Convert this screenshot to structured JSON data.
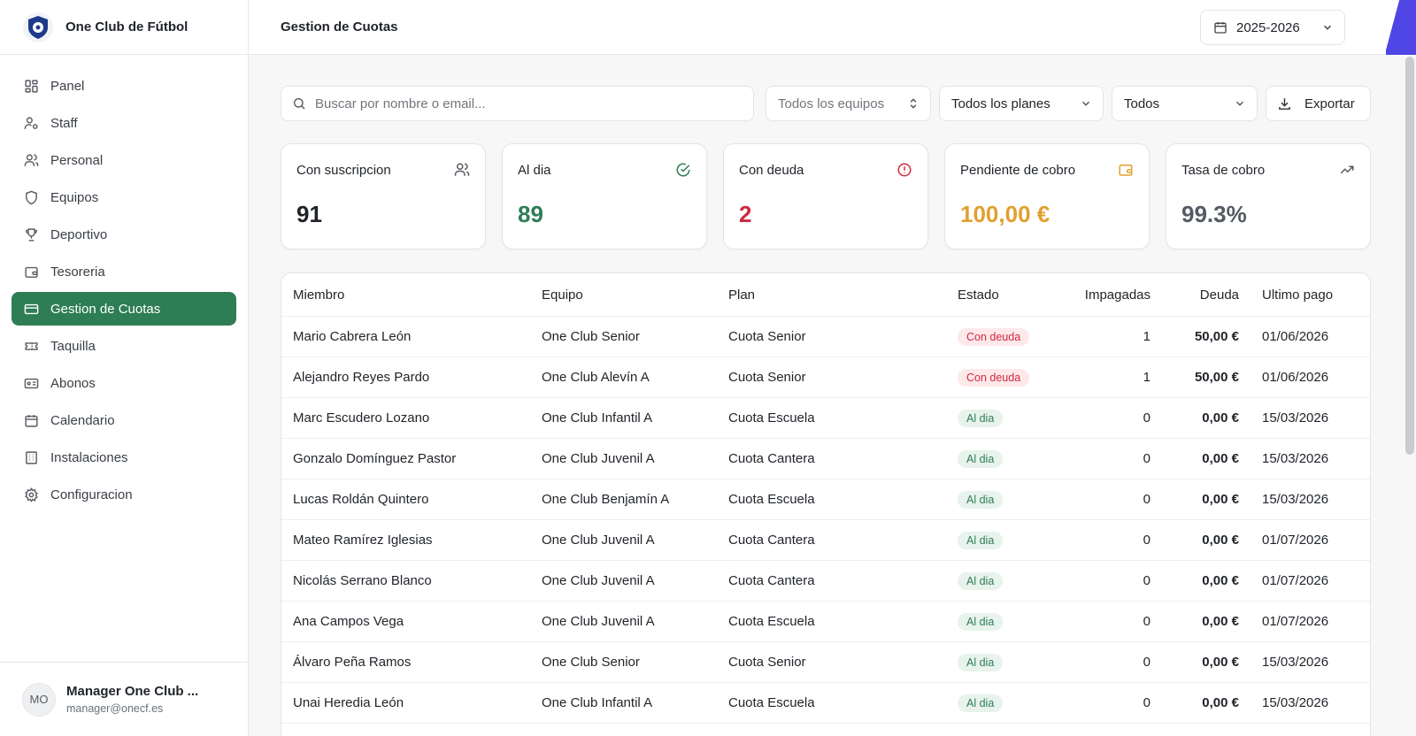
{
  "app": {
    "name": "One Club de Fútbol"
  },
  "sidebar": {
    "items": [
      {
        "label": "Panel",
        "icon": "dashboard-icon"
      },
      {
        "label": "Staff",
        "icon": "user-cog-icon"
      },
      {
        "label": "Personal",
        "icon": "users-icon"
      },
      {
        "label": "Equipos",
        "icon": "shield-icon"
      },
      {
        "label": "Deportivo",
        "icon": "trophy-icon"
      },
      {
        "label": "Tesoreria",
        "icon": "wallet-icon"
      },
      {
        "label": "Gestion de Cuotas",
        "icon": "credit-card-icon",
        "active": true
      },
      {
        "label": "Taquilla",
        "icon": "ticket-icon"
      },
      {
        "label": "Abonos",
        "icon": "id-card-icon"
      },
      {
        "label": "Calendario",
        "icon": "calendar-icon"
      },
      {
        "label": "Instalaciones",
        "icon": "building-icon"
      },
      {
        "label": "Configuracion",
        "icon": "gear-icon"
      }
    ]
  },
  "user": {
    "initials": "MO",
    "name": "Manager One Club ...",
    "email": "manager@onecf.es"
  },
  "header": {
    "title": "Gestion de Cuotas",
    "season": "2025-2026"
  },
  "filters": {
    "search_placeholder": "Buscar por nombre o email...",
    "team": "Todos los equipos",
    "plan": "Todos los planes",
    "status": "Todos",
    "export_label": "Exportar"
  },
  "stats": {
    "subscribed": {
      "label": "Con suscripcion",
      "value": "91"
    },
    "up_to_date": {
      "label": "Al dia",
      "value": "89"
    },
    "in_debt": {
      "label": "Con deuda",
      "value": "2"
    },
    "pending": {
      "label": "Pendiente de cobro",
      "value": "100,00 €"
    },
    "rate": {
      "label": "Tasa de cobro",
      "value": "99.3%"
    }
  },
  "colors": {
    "accent": "#2e7d55",
    "debt": "#d0293f",
    "pending": "#e0a030",
    "rate": "#555b63"
  },
  "table": {
    "columns": [
      "Miembro",
      "Equipo",
      "Plan",
      "Estado",
      "Impagadas",
      "Deuda",
      "Ultimo pago"
    ],
    "rows": [
      {
        "member": "Mario Cabrera León",
        "team": "One Club Senior",
        "plan": "Cuota Senior",
        "status": "Con deuda",
        "unpaid": "1",
        "debt": "50,00 €",
        "last": "01/06/2026"
      },
      {
        "member": "Alejandro Reyes Pardo",
        "team": "One Club Alevín A",
        "plan": "Cuota Senior",
        "status": "Con deuda",
        "unpaid": "1",
        "debt": "50,00 €",
        "last": "01/06/2026"
      },
      {
        "member": "Marc Escudero Lozano",
        "team": "One Club Infantil A",
        "plan": "Cuota Escuela",
        "status": "Al dia",
        "unpaid": "0",
        "debt": "0,00 €",
        "last": "15/03/2026"
      },
      {
        "member": "Gonzalo Domínguez Pastor",
        "team": "One Club Juvenil A",
        "plan": "Cuota Cantera",
        "status": "Al dia",
        "unpaid": "0",
        "debt": "0,00 €",
        "last": "15/03/2026"
      },
      {
        "member": "Lucas Roldán Quintero",
        "team": "One Club Benjamín A",
        "plan": "Cuota Escuela",
        "status": "Al dia",
        "unpaid": "0",
        "debt": "0,00 €",
        "last": "15/03/2026"
      },
      {
        "member": "Mateo Ramírez Iglesias",
        "team": "One Club Juvenil A",
        "plan": "Cuota Cantera",
        "status": "Al dia",
        "unpaid": "0",
        "debt": "0,00 €",
        "last": "01/07/2026"
      },
      {
        "member": "Nicolás Serrano Blanco",
        "team": "One Club Juvenil A",
        "plan": "Cuota Cantera",
        "status": "Al dia",
        "unpaid": "0",
        "debt": "0,00 €",
        "last": "01/07/2026"
      },
      {
        "member": "Ana Campos Vega",
        "team": "One Club Juvenil A",
        "plan": "Cuota Escuela",
        "status": "Al dia",
        "unpaid": "0",
        "debt": "0,00 €",
        "last": "01/07/2026"
      },
      {
        "member": "Álvaro Peña Ramos",
        "team": "One Club Senior",
        "plan": "Cuota Senior",
        "status": "Al dia",
        "unpaid": "0",
        "debt": "0,00 €",
        "last": "15/03/2026"
      },
      {
        "member": "Unai Heredia León",
        "team": "One Club Infantil A",
        "plan": "Cuota Escuela",
        "status": "Al dia",
        "unpaid": "0",
        "debt": "0,00 €",
        "last": "15/03/2026"
      }
    ]
  }
}
